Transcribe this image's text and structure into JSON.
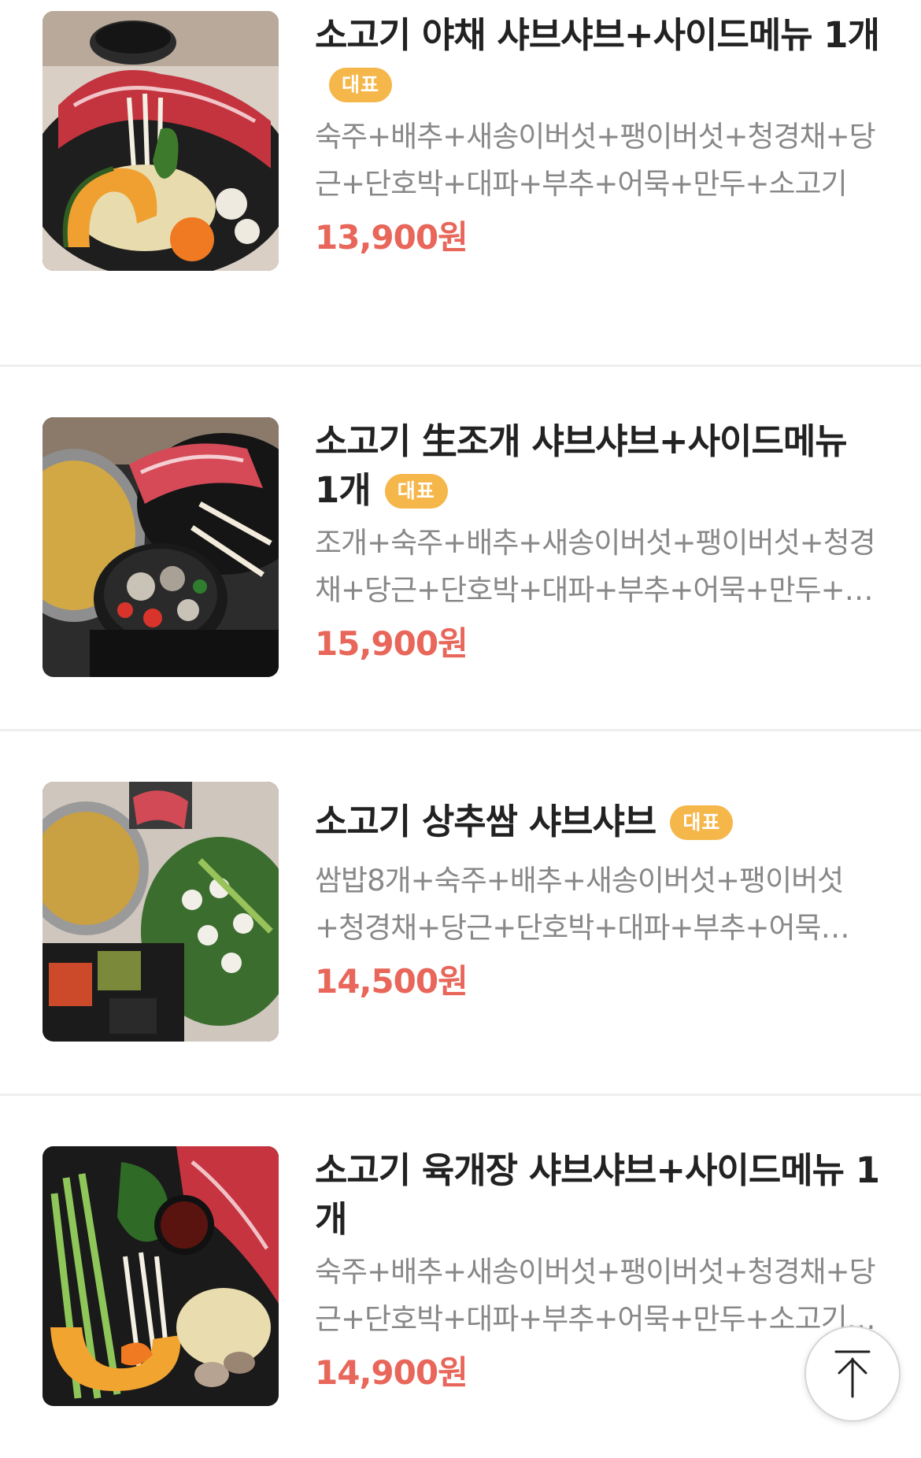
{
  "badge_label": "대표",
  "accent": {
    "price": "#e8665a",
    "badge": "#f5b64a"
  },
  "menu": [
    {
      "name": "소고기 야채 샤브샤브+사이드메뉴 1개",
      "has_badge": true,
      "description": "숙주+배추+새송이버섯+팽이버섯+청경채+당근+단호박+대파+부추+어묵+만두+소고기",
      "price": "13,900원"
    },
    {
      "name": "소고기 生조개 샤브샤브+사이드메뉴 1개",
      "has_badge": true,
      "description": "조개+숙주+배추+새송이버섯+팽이버섯+청경채+당근+단호박+대파+부추+어묵+만두+…",
      "price": "15,900원"
    },
    {
      "name": "소고기 상추쌈 샤브샤브",
      "has_badge": true,
      "description": "쌈밥8개+숙주+배추+새송이버섯+팽이버섯+청경채+당근+단호박+대파+부추+어묵+만…",
      "price": "14,500원"
    },
    {
      "name": "소고기 육개장 샤브샤브+사이드메뉴 1개",
      "has_badge": false,
      "description": "숙주+배추+새송이버섯+팽이버섯+청경채+당근+단호박+대파+부추+어묵+만두+소고기…",
      "price": "14,900원"
    }
  ],
  "scroll_top_icon": "arrow-up-to-top-icon"
}
